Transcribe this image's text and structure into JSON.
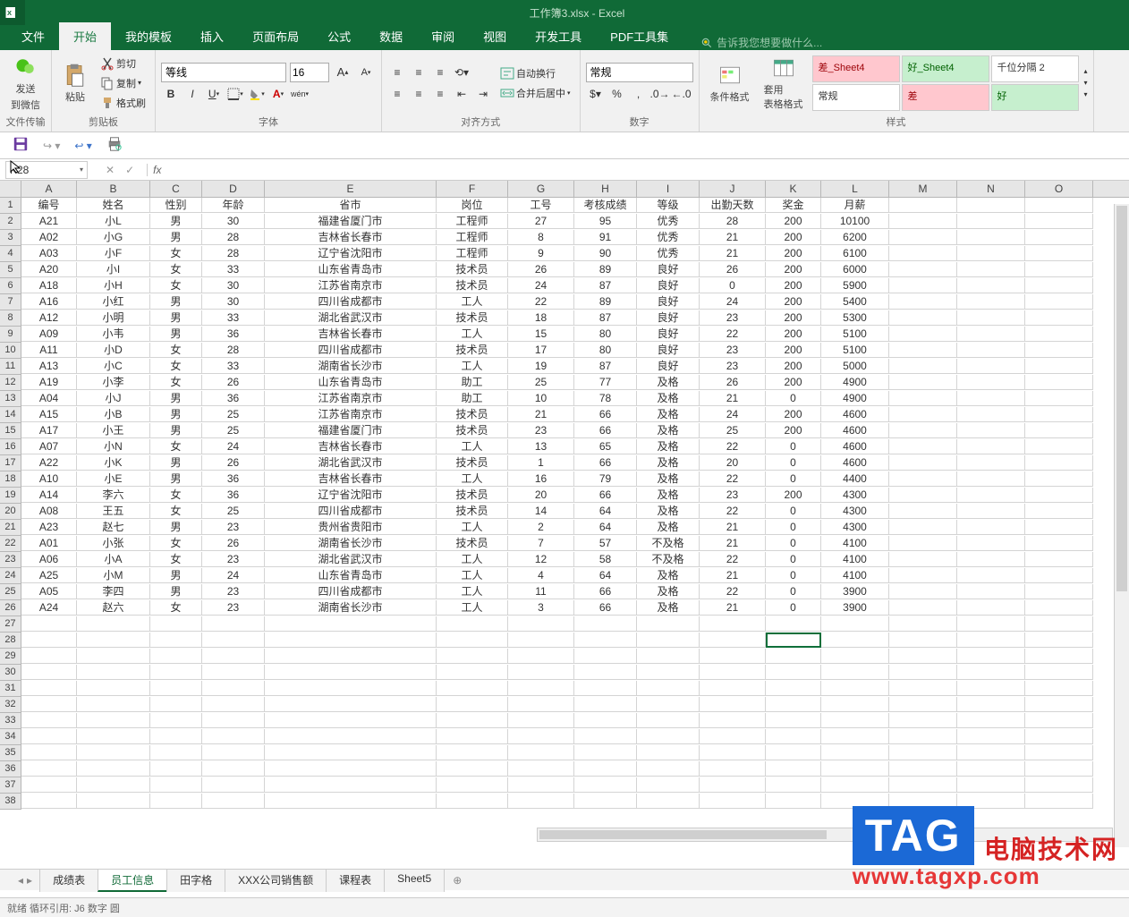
{
  "window": {
    "title": "工作簿3.xlsx - Excel"
  },
  "tabs": {
    "file": "文件",
    "home": "开始",
    "template": "我的模板",
    "insert": "插入",
    "layout": "页面布局",
    "formula": "公式",
    "data": "数据",
    "review": "审阅",
    "view": "视图",
    "dev": "开发工具",
    "pdf": "PDF工具集",
    "tellme": "告诉我您想要做什么..."
  },
  "ribbon": {
    "share": {
      "send": "发送",
      "wechat": "到微信",
      "group": "文件传输"
    },
    "clipboard": {
      "paste": "粘贴",
      "cut": "剪切",
      "copy": "复制",
      "format_painter": "格式刷",
      "group": "剪贴板"
    },
    "font": {
      "name": "等线",
      "size": "16",
      "group": "字体"
    },
    "alignment": {
      "wrap": "自动换行",
      "merge": "合并后居中",
      "group": "对齐方式"
    },
    "number": {
      "format": "常规",
      "group": "数字"
    },
    "styles": {
      "cond": "条件格式",
      "table": "套用\n表格格式",
      "s1": "差_Sheet4",
      "s2": "好_Sheet4",
      "s3": "千位分隔 2",
      "s4": "常规",
      "s5": "差",
      "s6": "好",
      "group": "样式"
    }
  },
  "name_box": "K28",
  "columns": [
    "A",
    "B",
    "C",
    "D",
    "E",
    "F",
    "G",
    "H",
    "I",
    "J",
    "K",
    "L",
    "M",
    "N",
    "O"
  ],
  "col_classes": [
    "c-A",
    "c-B",
    "c-C",
    "c-D",
    "c-E",
    "c-F",
    "c-G",
    "c-H",
    "c-I",
    "c-J",
    "c-K",
    "c-L",
    "c-M",
    "c-N",
    "c-O"
  ],
  "headers": [
    "编号",
    "姓名",
    "性别",
    "年龄",
    "省市",
    "岗位",
    "工号",
    "考核成绩",
    "等级",
    "出勤天数",
    "奖金",
    "月薪"
  ],
  "rows": [
    [
      "A21",
      "小L",
      "男",
      "30",
      "福建省厦门市",
      "工程师",
      "27",
      "95",
      "优秀",
      "28",
      "200",
      "10100"
    ],
    [
      "A02",
      "小G",
      "男",
      "28",
      "吉林省长春市",
      "工程师",
      "8",
      "91",
      "优秀",
      "21",
      "200",
      "6200"
    ],
    [
      "A03",
      "小F",
      "女",
      "28",
      "辽宁省沈阳市",
      "工程师",
      "9",
      "90",
      "优秀",
      "21",
      "200",
      "6100"
    ],
    [
      "A20",
      "小I",
      "女",
      "33",
      "山东省青岛市",
      "技术员",
      "26",
      "89",
      "良好",
      "26",
      "200",
      "6000"
    ],
    [
      "A18",
      "小H",
      "女",
      "30",
      "江苏省南京市",
      "技术员",
      "24",
      "87",
      "良好",
      "0",
      "200",
      "5900"
    ],
    [
      "A16",
      "小红",
      "男",
      "30",
      "四川省成都市",
      "工人",
      "22",
      "89",
      "良好",
      "24",
      "200",
      "5400"
    ],
    [
      "A12",
      "小明",
      "男",
      "33",
      "湖北省武汉市",
      "技术员",
      "18",
      "87",
      "良好",
      "23",
      "200",
      "5300"
    ],
    [
      "A09",
      "小韦",
      "男",
      "36",
      "吉林省长春市",
      "工人",
      "15",
      "80",
      "良好",
      "22",
      "200",
      "5100"
    ],
    [
      "A11",
      "小D",
      "女",
      "28",
      "四川省成都市",
      "技术员",
      "17",
      "80",
      "良好",
      "23",
      "200",
      "5100"
    ],
    [
      "A13",
      "小C",
      "女",
      "33",
      "湖南省长沙市",
      "工人",
      "19",
      "87",
      "良好",
      "23",
      "200",
      "5000"
    ],
    [
      "A19",
      "小李",
      "女",
      "26",
      "山东省青岛市",
      "助工",
      "25",
      "77",
      "及格",
      "26",
      "200",
      "4900"
    ],
    [
      "A04",
      "小J",
      "男",
      "36",
      "江苏省南京市",
      "助工",
      "10",
      "78",
      "及格",
      "21",
      "0",
      "4900"
    ],
    [
      "A15",
      "小B",
      "男",
      "25",
      "江苏省南京市",
      "技术员",
      "21",
      "66",
      "及格",
      "24",
      "200",
      "4600"
    ],
    [
      "A17",
      "小王",
      "男",
      "25",
      "福建省厦门市",
      "技术员",
      "23",
      "66",
      "及格",
      "25",
      "200",
      "4600"
    ],
    [
      "A07",
      "小N",
      "女",
      "24",
      "吉林省长春市",
      "工人",
      "13",
      "65",
      "及格",
      "22",
      "0",
      "4600"
    ],
    [
      "A22",
      "小K",
      "男",
      "26",
      "湖北省武汉市",
      "技术员",
      "1",
      "66",
      "及格",
      "20",
      "0",
      "4600"
    ],
    [
      "A10",
      "小E",
      "男",
      "36",
      "吉林省长春市",
      "工人",
      "16",
      "79",
      "及格",
      "22",
      "0",
      "4400"
    ],
    [
      "A14",
      "李六",
      "女",
      "36",
      "辽宁省沈阳市",
      "技术员",
      "20",
      "66",
      "及格",
      "23",
      "200",
      "4300"
    ],
    [
      "A08",
      "王五",
      "女",
      "25",
      "四川省成都市",
      "技术员",
      "14",
      "64",
      "及格",
      "22",
      "0",
      "4300"
    ],
    [
      "A23",
      "赵七",
      "男",
      "23",
      "贵州省贵阳市",
      "工人",
      "2",
      "64",
      "及格",
      "21",
      "0",
      "4300"
    ],
    [
      "A01",
      "小张",
      "女",
      "26",
      "湖南省长沙市",
      "技术员",
      "7",
      "57",
      "不及格",
      "21",
      "0",
      "4100"
    ],
    [
      "A06",
      "小A",
      "女",
      "23",
      "湖北省武汉市",
      "工人",
      "12",
      "58",
      "不及格",
      "22",
      "0",
      "4100"
    ],
    [
      "A25",
      "小M",
      "男",
      "24",
      "山东省青岛市",
      "工人",
      "4",
      "64",
      "及格",
      "21",
      "0",
      "4100"
    ],
    [
      "A05",
      "李四",
      "男",
      "23",
      "四川省成都市",
      "工人",
      "11",
      "66",
      "及格",
      "22",
      "0",
      "3900"
    ],
    [
      "A24",
      "赵六",
      "女",
      "23",
      "湖南省长沙市",
      "工人",
      "3",
      "66",
      "及格",
      "21",
      "0",
      "3900"
    ]
  ],
  "sheets": [
    "成绩表",
    "员工信息",
    "田字格",
    "XXX公司销售额",
    "课程表",
    "Sheet5"
  ],
  "active_sheet": 1,
  "status": "就绪  循环引用: J6  数字  圆",
  "watermark": {
    "tag": "TAG",
    "cn": "电脑技术网",
    "url": "www.tagxp.com"
  }
}
